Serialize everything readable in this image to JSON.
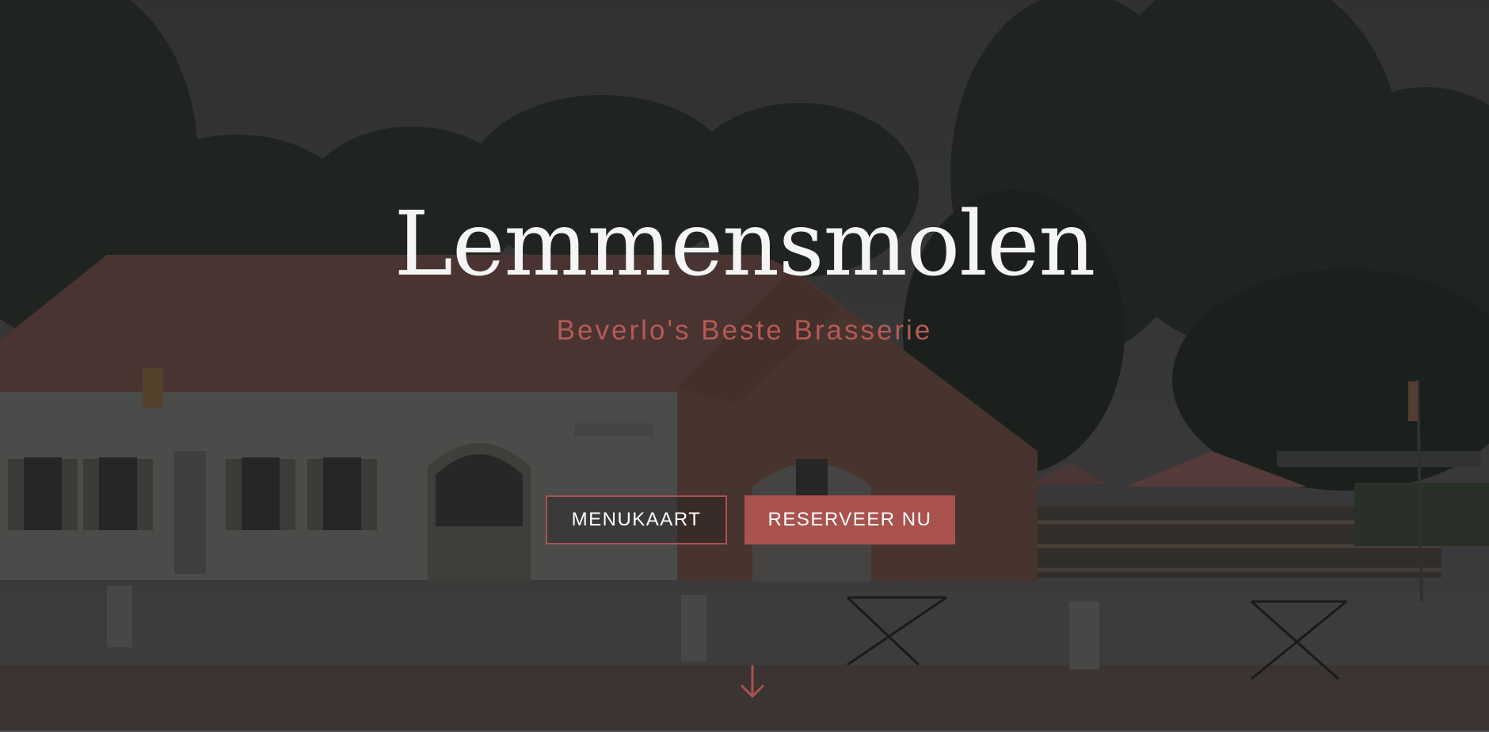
{
  "hero": {
    "title": "Lemmensmolen",
    "subtitle": "Beverlo's Beste Brasserie",
    "menu_button": "MENUKAART",
    "reserve_button": "RESERVEER NU",
    "scroll_icon": "arrow-down-icon",
    "background_image": "brasserie-building-photo"
  },
  "colors": {
    "accent": "#a9524e",
    "subtitle": "#b55a56",
    "title": "#f5f5f5",
    "overlay": "#141414"
  }
}
